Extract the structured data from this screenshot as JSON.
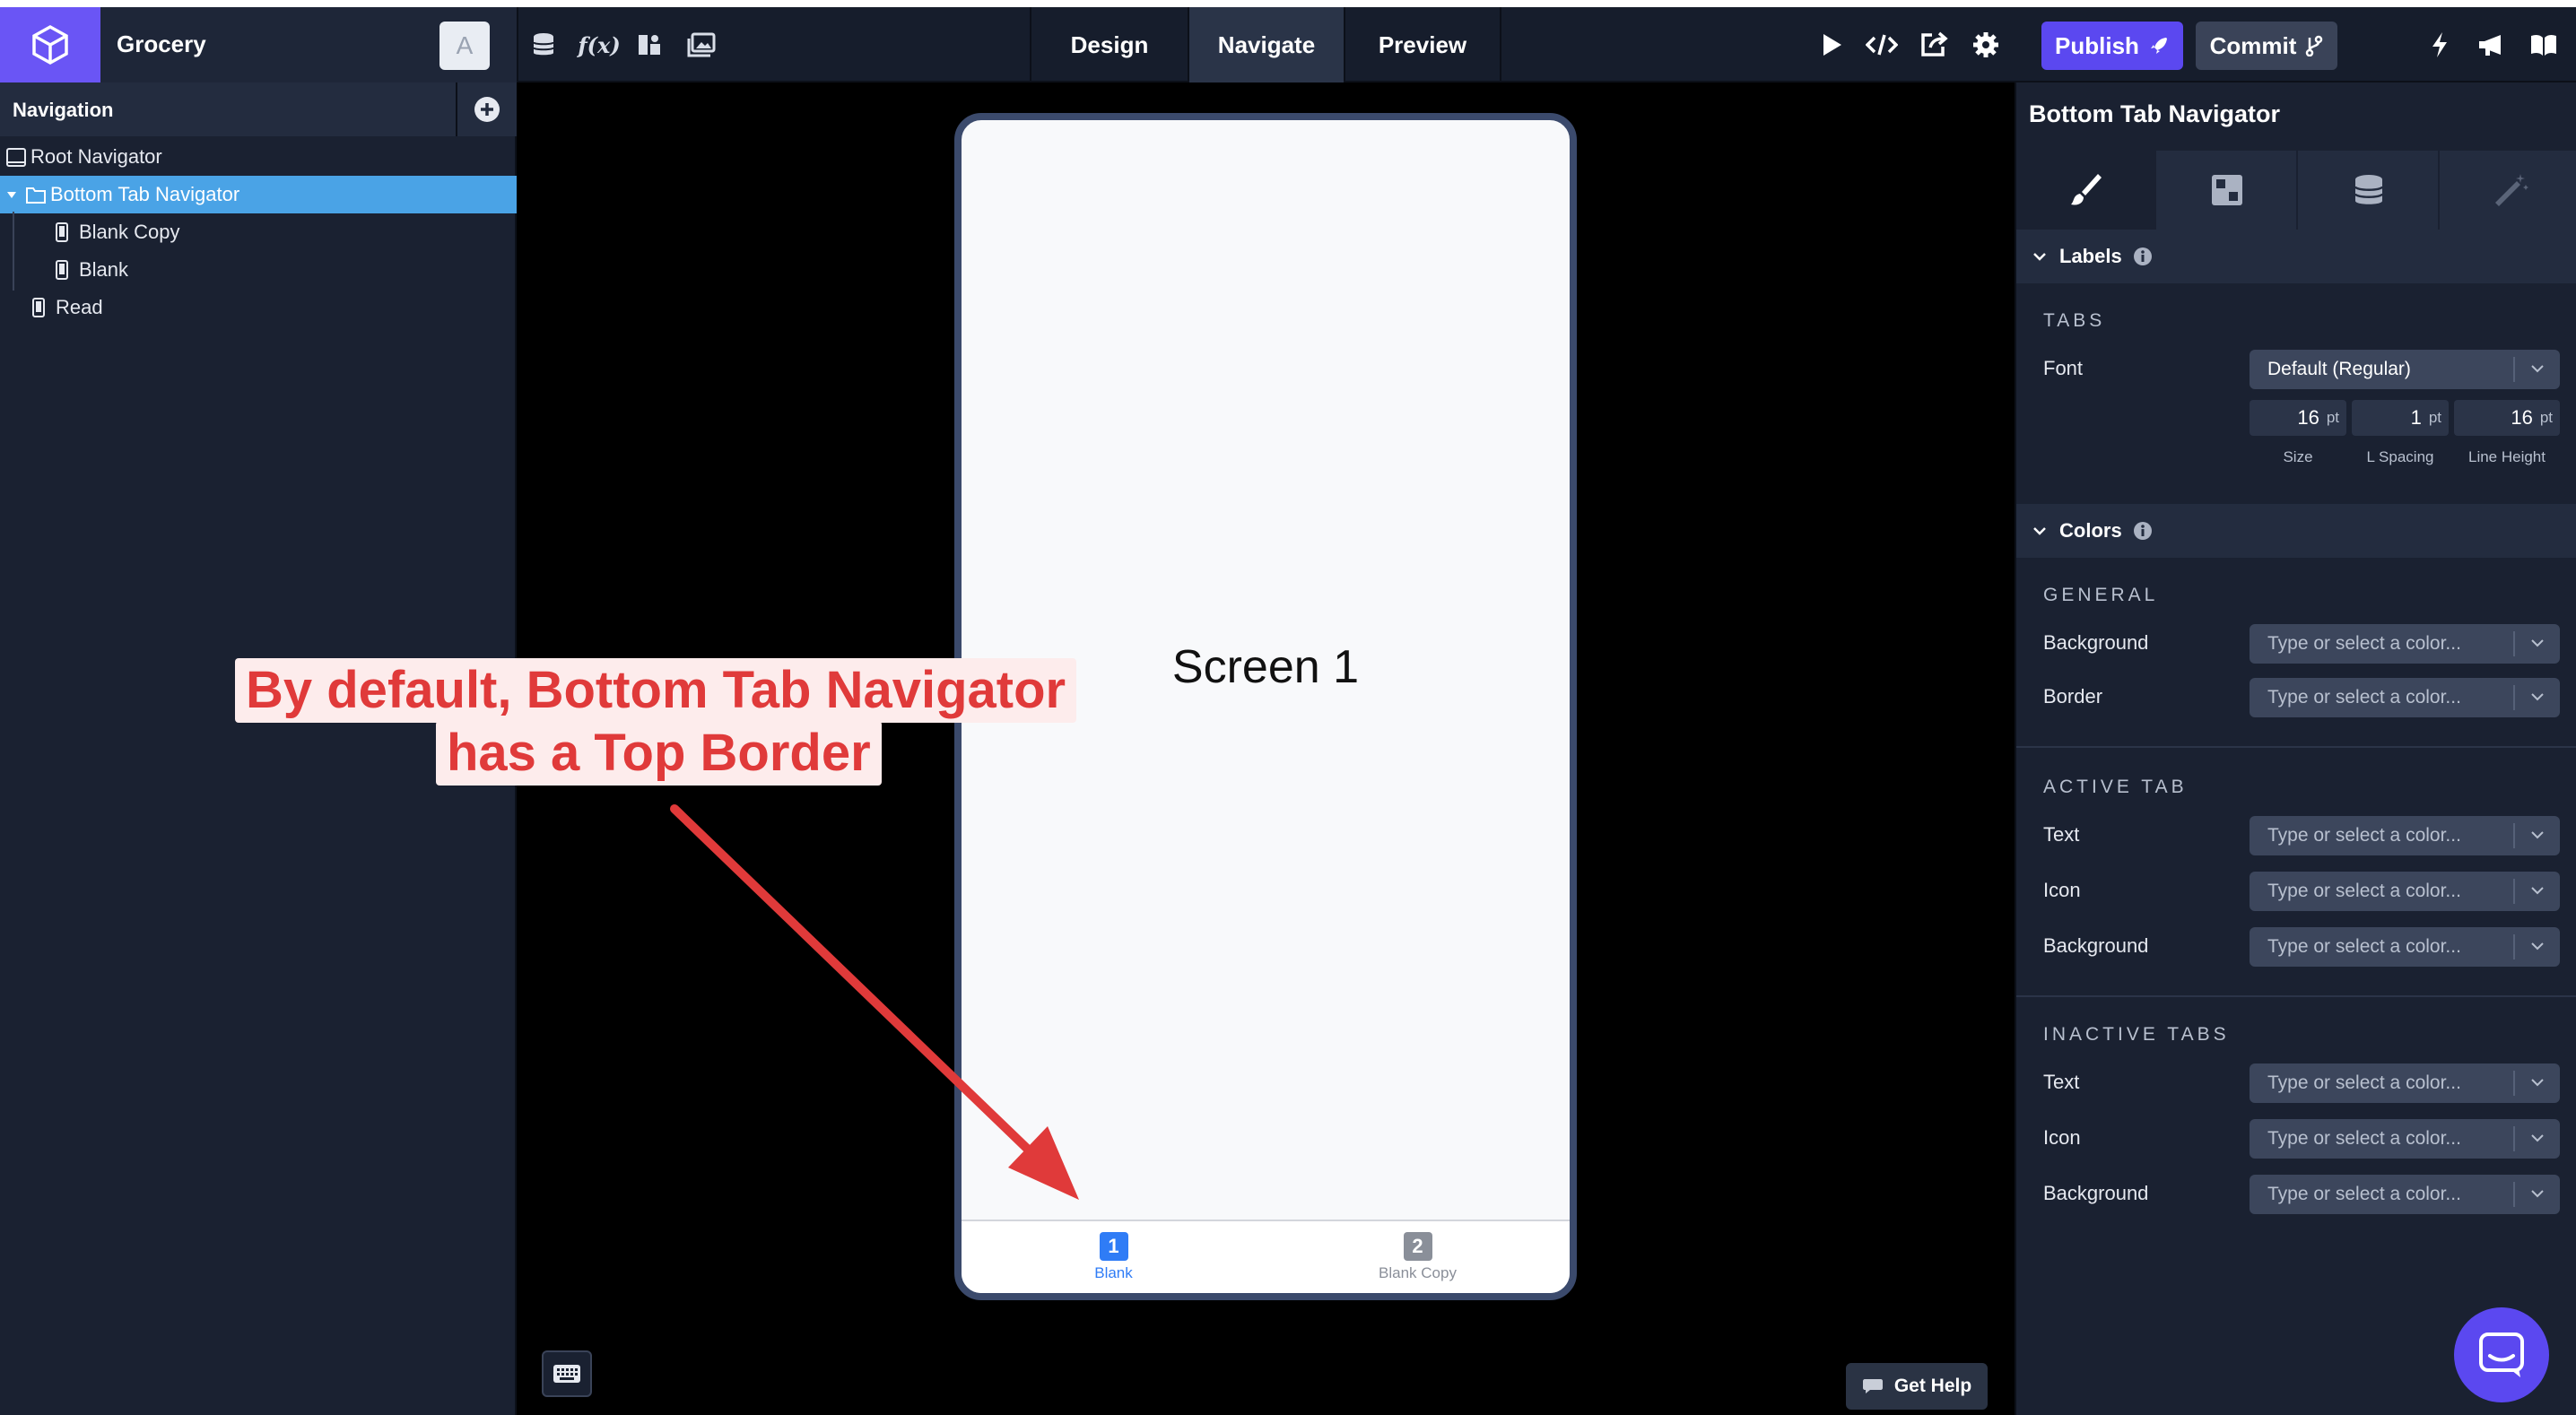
{
  "app": {
    "project_name": "Grocery",
    "avatar_letter": "A"
  },
  "mode_tabs": [
    {
      "label": "Design",
      "active": false
    },
    {
      "label": "Navigate",
      "active": true
    },
    {
      "label": "Preview",
      "active": false
    }
  ],
  "toolbar": {
    "publish_label": "Publish",
    "commit_label": "Commit"
  },
  "navigation": {
    "title": "Navigation",
    "tree": [
      {
        "label": "Root Navigator",
        "icon": "tablet-icon",
        "level": 0
      },
      {
        "label": "Bottom Tab Navigator",
        "icon": "folder-icon",
        "level": 1,
        "selected": true
      },
      {
        "label": "Blank Copy",
        "icon": "phone-icon",
        "level": 2
      },
      {
        "label": "Blank",
        "icon": "phone-icon",
        "level": 2
      },
      {
        "label": "Read",
        "icon": "phone-icon",
        "level": 1
      }
    ]
  },
  "canvas": {
    "screen_label": "Screen 1",
    "tabs": [
      {
        "badge": "1",
        "label": "Blank",
        "active": true
      },
      {
        "badge": "2",
        "label": "Blank Copy",
        "active": false
      }
    ],
    "help_label": "Get Help"
  },
  "annotation": {
    "line1": "By default, Bottom Tab Navigator",
    "line2": "has a Top Border",
    "color": "#e03a3a"
  },
  "properties": {
    "title": "Bottom Tab Navigator",
    "labels_section": "Labels",
    "tabs_heading": "TABS",
    "font_label": "Font",
    "font_value": "Default (Regular)",
    "size_value": "16",
    "spacing_value": "1",
    "line_height_value": "16",
    "unit": "pt",
    "size_caption": "Size",
    "spacing_caption": "L Spacing",
    "line_height_caption": "Line Height",
    "colors_section": "Colors",
    "general_heading": "GENERAL",
    "active_heading": "ACTIVE TAB",
    "inactive_heading": "INACTIVE TABS",
    "background_label": "Background",
    "border_label": "Border",
    "text_label": "Text",
    "icon_label": "Icon",
    "color_placeholder": "Type or select a color..."
  },
  "colors": {
    "accent": "#5b48f0",
    "selected_row": "#4aa3e6",
    "active_tab": "#2f7cf6",
    "inactive_tab": "#8a8f99"
  }
}
